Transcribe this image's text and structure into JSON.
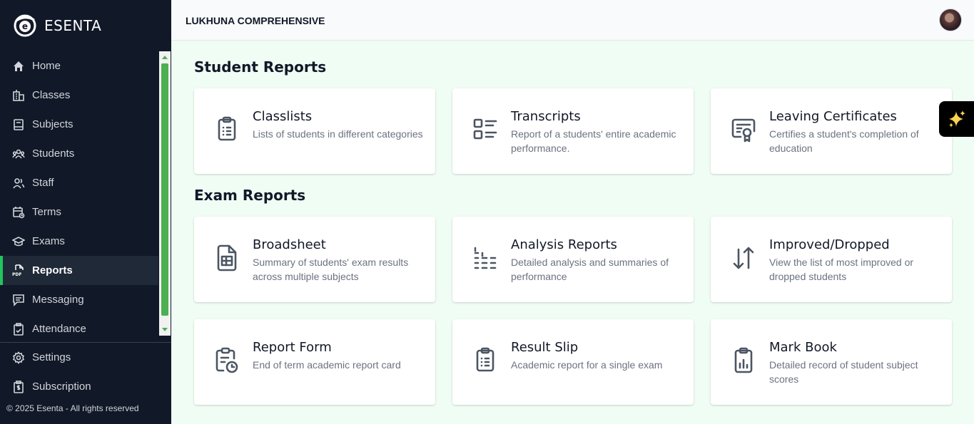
{
  "brand": {
    "name": "ESENTA"
  },
  "sidebar": {
    "items": [
      {
        "label": "Home",
        "icon": "home-icon"
      },
      {
        "label": "Classes",
        "icon": "classes-icon"
      },
      {
        "label": "Subjects",
        "icon": "subjects-icon"
      },
      {
        "label": "Students",
        "icon": "students-icon"
      },
      {
        "label": "Staff",
        "icon": "staff-icon"
      },
      {
        "label": "Terms",
        "icon": "terms-icon"
      },
      {
        "label": "Exams",
        "icon": "exams-icon"
      },
      {
        "label": "Reports",
        "icon": "pdf-icon",
        "active": true
      },
      {
        "label": "Messaging",
        "icon": "messaging-icon"
      },
      {
        "label": "Attendance",
        "icon": "attendance-icon"
      }
    ],
    "footer": [
      {
        "label": "Settings",
        "icon": "gear-icon"
      },
      {
        "label": "Subscription",
        "icon": "subscription-icon"
      }
    ],
    "copyright": "© 2025 Esenta - All rights reserved"
  },
  "topbar": {
    "school_name": "LUKHUNA COMPREHENSIVE"
  },
  "sections": [
    {
      "title": "Student Reports",
      "cards": [
        {
          "title": "Classlists",
          "desc": "Lists of students in different categories",
          "icon": "clipboard-list-icon"
        },
        {
          "title": "Transcripts",
          "desc": "Report of a students' entire academic performance.",
          "icon": "list-details-icon"
        },
        {
          "title": "Leaving Certificates",
          "desc": "Certifies a student's completion of education",
          "icon": "certificate-icon"
        }
      ]
    },
    {
      "title": "Exam Reports",
      "cards": [
        {
          "title": "Broadsheet",
          "desc": "Summary of students' exam results across multiple subjects",
          "icon": "spreadsheet-icon"
        },
        {
          "title": "Analysis Reports",
          "desc": "Detailed analysis and summaries of performance",
          "icon": "analysis-grid-icon"
        },
        {
          "title": "Improved/Dropped",
          "desc": "View the list of most improved or dropped students",
          "icon": "arrows-sort-icon"
        },
        {
          "title": "Report Form",
          "desc": "End of term academic report card",
          "icon": "report-clock-icon"
        },
        {
          "title": "Result Slip",
          "desc": "Academic report for a single exam",
          "icon": "clipboard-list-icon"
        },
        {
          "title": "Mark Book",
          "desc": "Detailed record of student subject scores",
          "icon": "clipboard-chart-icon"
        }
      ]
    }
  ],
  "colors": {
    "sidebar": "#111827",
    "accent": "#22c55e",
    "content_bg": "#f0fdf4",
    "icon": "#4b5563"
  }
}
